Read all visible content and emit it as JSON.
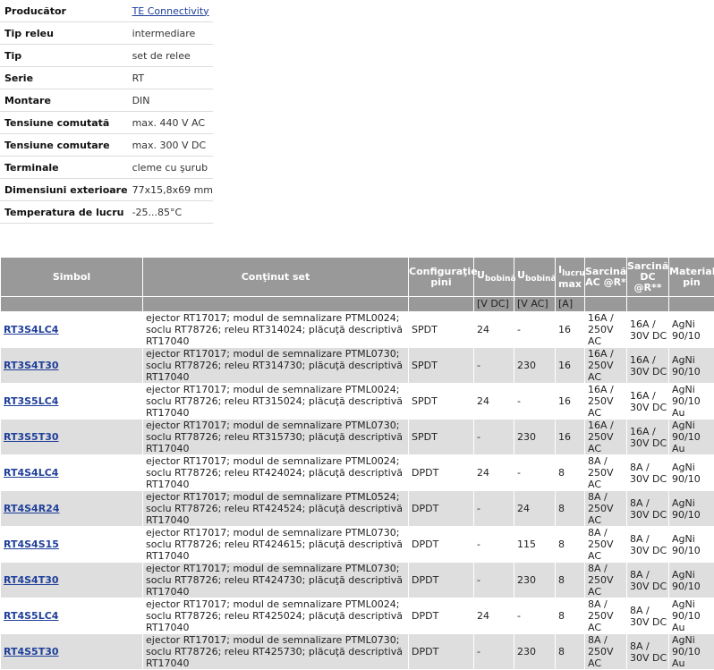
{
  "spec": [
    {
      "label": "Producător",
      "value": "TE Connectivity",
      "link": true
    },
    {
      "label": "Tip releu",
      "value": "intermediare"
    },
    {
      "label": "Tip",
      "value": "set de relee"
    },
    {
      "label": "Serie",
      "value": "RT"
    },
    {
      "label": "Montare",
      "value": "DIN"
    },
    {
      "label": "Tensiune comutată",
      "value": "max. 440 V AC"
    },
    {
      "label": "Tensiune comutare",
      "value": "max. 300 V DC"
    },
    {
      "label": "Terminale",
      "value": "cleme cu şurub"
    },
    {
      "label": "Dimensiuni exterioare",
      "value": "77x15,8x69 mm"
    },
    {
      "label": "Temperatura de lucru",
      "value": "-25...85°C"
    }
  ],
  "table": {
    "headers": {
      "symbol": "Simbol",
      "content": "Conţinut set",
      "config": "Configuraţie pini",
      "u_main": "U",
      "u_sub_dc": "bobină",
      "u_sub_ac": "bobină",
      "i_main": "I",
      "i_sub": "lucru",
      "i_tail": "max",
      "load_ac": "Sarcină AC @R*",
      "load_dc": "Sarcină DC @R**",
      "material": "Material pin"
    },
    "units": {
      "u_dc": "[V DC]",
      "u_ac": "[V AC]",
      "i": "[A]"
    },
    "rows": [
      {
        "symbol": "RT3S4LC4",
        "content": "ejector RT17017; modul de semnalizare PTML0024; soclu RT78726; releu RT314024; plăcuţă descriptivă RT17040",
        "config": "SPDT",
        "udc": "24",
        "uac": "-",
        "i": "16",
        "ac": "16A / 250V AC",
        "dc": "16A / 30V DC",
        "mat": "AgNi 90/10"
      },
      {
        "symbol": "RT3S4T30",
        "content": "ejector RT17017; modul de semnalizare PTML0730; soclu RT78726; releu RT314730; plăcuţă descriptivă RT17040",
        "config": "SPDT",
        "udc": "-",
        "uac": "230",
        "i": "16",
        "ac": "16A / 250V AC",
        "dc": "16A / 30V DC",
        "mat": "AgNi 90/10"
      },
      {
        "symbol": "RT3S5LC4",
        "content": "ejector RT17017; modul de semnalizare PTML0024; soclu RT78726; releu RT315024; plăcuţă descriptivă RT17040",
        "config": "SPDT",
        "udc": "24",
        "uac": "-",
        "i": "16",
        "ac": "16A / 250V AC",
        "dc": "16A / 30V DC",
        "mat": "AgNi 90/10 Au"
      },
      {
        "symbol": "RT3S5T30",
        "content": "ejector RT17017; modul de semnalizare PTML0730; soclu RT78726; releu RT315730; plăcuţă descriptivă RT17040",
        "config": "SPDT",
        "udc": "-",
        "uac": "230",
        "i": "16",
        "ac": "16A / 250V AC",
        "dc": "16A / 30V DC",
        "mat": "AgNi 90/10 Au"
      },
      {
        "symbol": "RT4S4LC4",
        "content": "ejector RT17017; modul de semnalizare PTML0024; soclu RT78726; releu RT424024; plăcuţă descriptivă RT17040",
        "config": "DPDT",
        "udc": "24",
        "uac": "-",
        "i": "8",
        "ac": "8A / 250V AC",
        "dc": "8A / 30V DC",
        "mat": "AgNi 90/10"
      },
      {
        "symbol": "RT4S4R24",
        "content": "ejector RT17017; modul de semnalizare PTML0524; soclu RT78726; releu RT424524; plăcuţă descriptivă RT17040",
        "config": "DPDT",
        "udc": "-",
        "uac": "24",
        "i": "8",
        "ac": "8A / 250V AC",
        "dc": "8A / 30V DC",
        "mat": "AgNi 90/10"
      },
      {
        "symbol": "RT4S4S15",
        "content": "ejector RT17017; modul de semnalizare PTML0730; soclu RT78726; releu RT424615; plăcuţă descriptivă RT17040",
        "config": "DPDT",
        "udc": "-",
        "uac": "115",
        "i": "8",
        "ac": "8A / 250V AC",
        "dc": "8A / 30V DC",
        "mat": "AgNi 90/10"
      },
      {
        "symbol": "RT4S4T30",
        "content": "ejector RT17017; modul de semnalizare PTML0730; soclu RT78726; releu RT424730; plăcuţă descriptivă RT17040",
        "config": "DPDT",
        "udc": "-",
        "uac": "230",
        "i": "8",
        "ac": "8A / 250V AC",
        "dc": "8A / 30V DC",
        "mat": "AgNi 90/10"
      },
      {
        "symbol": "RT4S5LC4",
        "content": "ejector RT17017; modul de semnalizare PTML0024; soclu RT78726; releu RT425024; plăcuţă descriptivă RT17040",
        "config": "DPDT",
        "udc": "24",
        "uac": "-",
        "i": "8",
        "ac": "8A / 250V AC",
        "dc": "8A / 30V DC",
        "mat": "AgNi 90/10 Au"
      },
      {
        "symbol": "RT4S5T30",
        "content": "ejector RT17017; modul de semnalizare PTML0730; soclu RT78726; releu RT425730; plăcuţă descriptivă RT17040",
        "config": "DPDT",
        "udc": "-",
        "uac": "230",
        "i": "8",
        "ac": "8A / 250V AC",
        "dc": "8A / 30V DC",
        "mat": "AgNi 90/10 Au"
      }
    ]
  }
}
